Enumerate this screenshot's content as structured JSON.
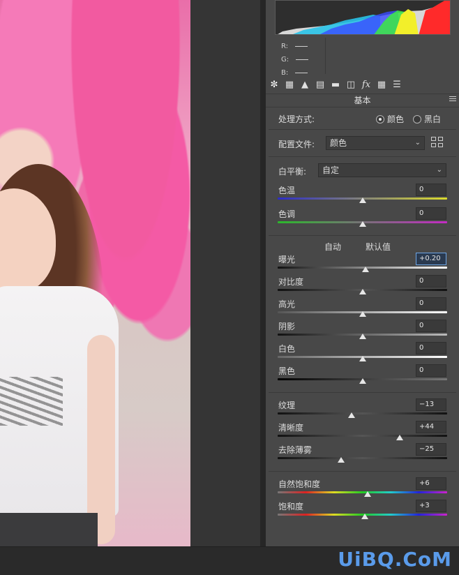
{
  "histogram": {
    "rgb_labels": [
      "R:",
      "G:",
      "B:"
    ]
  },
  "toolbar": {
    "icons": [
      "aperture-icon",
      "tone-curve-icon",
      "detail-icon",
      "hsl-icon",
      "split-toning-icon",
      "lens-icon",
      "fx-icon",
      "calibration-icon",
      "presets-icon"
    ]
  },
  "panel": {
    "section_title": "基本",
    "treatment_label": "处理方式:",
    "treatment_options": [
      "颜色",
      "黑白"
    ],
    "treatment_selected": "颜色",
    "profile_label": "配置文件:",
    "profile_value": "颜色",
    "wb_label": "白平衡:",
    "wb_value": "自定",
    "auto_label": "自动",
    "default_label": "默认值"
  },
  "sliders": [
    {
      "label": "色温",
      "value": "0",
      "level": 0.5
    },
    {
      "label": "色调",
      "value": "0",
      "level": 0.5
    },
    {
      "label": "曝光",
      "value": "+0.20",
      "level": 0.52
    },
    {
      "label": "对比度",
      "value": "0",
      "level": 0.5
    },
    {
      "label": "高光",
      "value": "0",
      "level": 0.5
    },
    {
      "label": "阴影",
      "value": "0",
      "level": 0.5
    },
    {
      "label": "白色",
      "value": "0",
      "level": 0.5
    },
    {
      "label": "黑色",
      "value": "0",
      "level": 0.5
    },
    {
      "label": "纹理",
      "value": "−13",
      "level": 0.435
    },
    {
      "label": "清晰度",
      "value": "+44",
      "level": 0.72
    },
    {
      "label": "去除薄雾",
      "value": "−25",
      "level": 0.375
    },
    {
      "label": "自然饱和度",
      "value": "+6",
      "level": 0.53
    },
    {
      "label": "饱和度",
      "value": "+3",
      "level": 0.515
    }
  ],
  "watermark": "UiBQ.CoM",
  "colors": {
    "panel_bg": "#484848",
    "focus_border": "#6ea6e6",
    "watermark": "#5a9bea"
  }
}
